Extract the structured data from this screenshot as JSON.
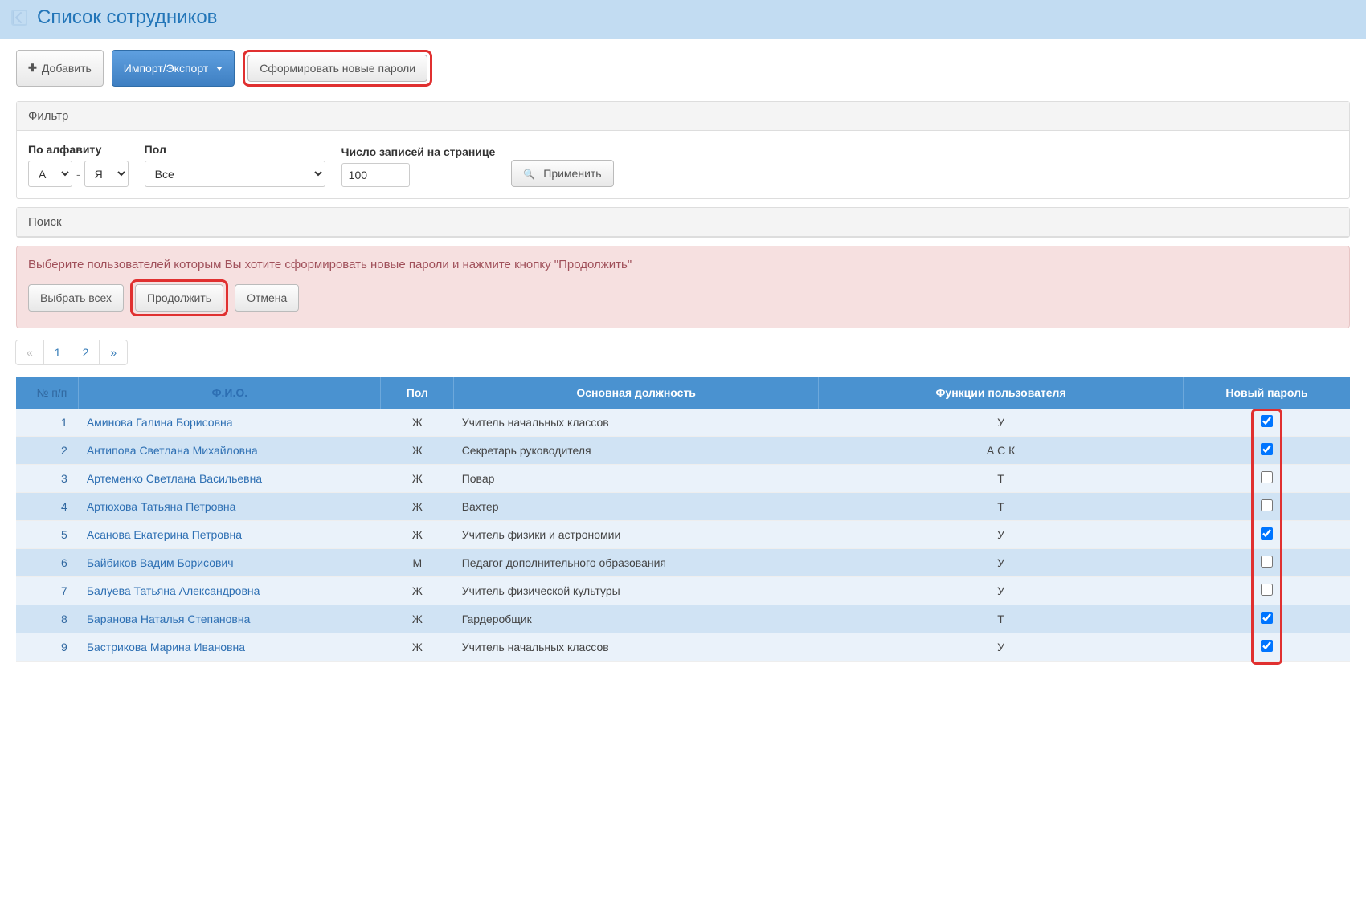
{
  "header": {
    "title": "Список сотрудников"
  },
  "toolbar": {
    "add_label": "Добавить",
    "import_export_label": "Импорт/Экспорт",
    "generate_passwords_label": "Сформировать новые пароли"
  },
  "filter": {
    "panel_title": "Фильтр",
    "alphabet_label": "По алфавиту",
    "alphabet_from": "А",
    "alphabet_to": "Я",
    "gender_label": "Пол",
    "gender_value": "Все",
    "records_label": "Число записей на странице",
    "records_value": "100",
    "apply_label": "Применить"
  },
  "search": {
    "panel_title": "Поиск"
  },
  "alert": {
    "text": "Выберите пользователей которым Вы хотите сформировать новые пароли и нажмите кнопку \"Продолжить\"",
    "select_all_label": "Выбрать всех",
    "continue_label": "Продолжить",
    "cancel_label": "Отмена"
  },
  "pagination": {
    "prev": "«",
    "pages": [
      "1",
      "2"
    ],
    "next": "»"
  },
  "table": {
    "headers": {
      "num": "№ п/п",
      "fio": "Ф.И.О.",
      "gender": "Пол",
      "position": "Основная должность",
      "functions": "Функции пользователя",
      "new_password": "Новый пароль"
    },
    "rows": [
      {
        "num": "1",
        "name": "Аминова Галина Борисовна",
        "gender": "Ж",
        "position": "Учитель начальных классов",
        "func": "У",
        "checked": true
      },
      {
        "num": "2",
        "name": "Антипова Светлана Михайловна",
        "gender": "Ж",
        "position": "Секретарь руководителя",
        "func": "А С К",
        "checked": true
      },
      {
        "num": "3",
        "name": "Артеменко Светлана Васильевна",
        "gender": "Ж",
        "position": "Повар",
        "func": "Т",
        "checked": false
      },
      {
        "num": "4",
        "name": "Артюхова Татьяна Петровна",
        "gender": "Ж",
        "position": "Вахтер",
        "func": "Т",
        "checked": false
      },
      {
        "num": "5",
        "name": "Асанова Екатерина Петровна",
        "gender": "Ж",
        "position": "Учитель физики и астрономии",
        "func": "У",
        "checked": true
      },
      {
        "num": "6",
        "name": "Байбиков Вадим Борисович",
        "gender": "М",
        "position": "Педагог дополнительного образования",
        "func": "У",
        "checked": false
      },
      {
        "num": "7",
        "name": "Балуева Татьяна Александровна",
        "gender": "Ж",
        "position": "Учитель физической культуры",
        "func": "У",
        "checked": false
      },
      {
        "num": "8",
        "name": "Баранова Наталья Степановна",
        "gender": "Ж",
        "position": "Гардеробщик",
        "func": "Т",
        "checked": true
      },
      {
        "num": "9",
        "name": "Бастрикова Марина Ивановна",
        "gender": "Ж",
        "position": "Учитель начальных классов",
        "func": "У",
        "checked": true
      }
    ]
  }
}
